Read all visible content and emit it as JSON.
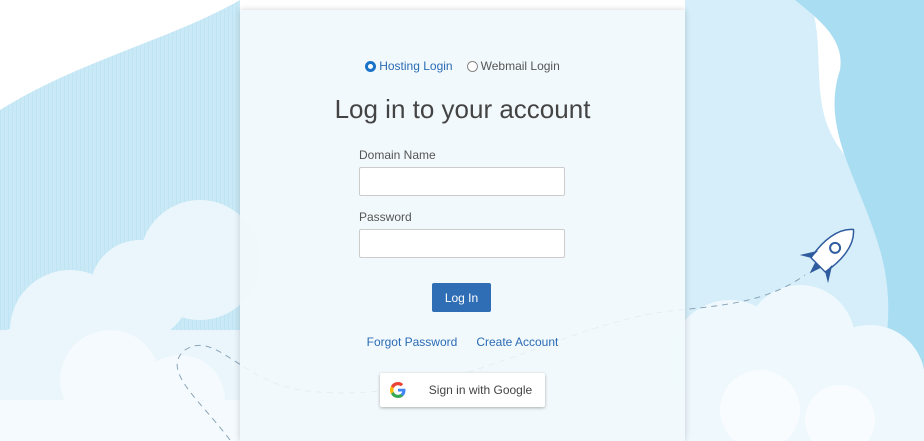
{
  "login_type": {
    "options": [
      {
        "label": "Hosting Login",
        "selected": true
      },
      {
        "label": "Webmail Login",
        "selected": false
      }
    ]
  },
  "title": "Log in to your account",
  "form": {
    "domain_label": "Domain Name",
    "domain_value": "",
    "password_label": "Password",
    "password_value": "",
    "submit_label": "Log In"
  },
  "links": {
    "forgot": "Forgot Password",
    "create": "Create Account"
  },
  "google": {
    "label": "Sign in with Google",
    "icon": "google-g-icon"
  },
  "colors": {
    "accent": "#2f6db5",
    "link": "#2a6bb5",
    "sky": "#a9ddf2"
  },
  "decoration": {
    "icon": "rocket-icon"
  }
}
